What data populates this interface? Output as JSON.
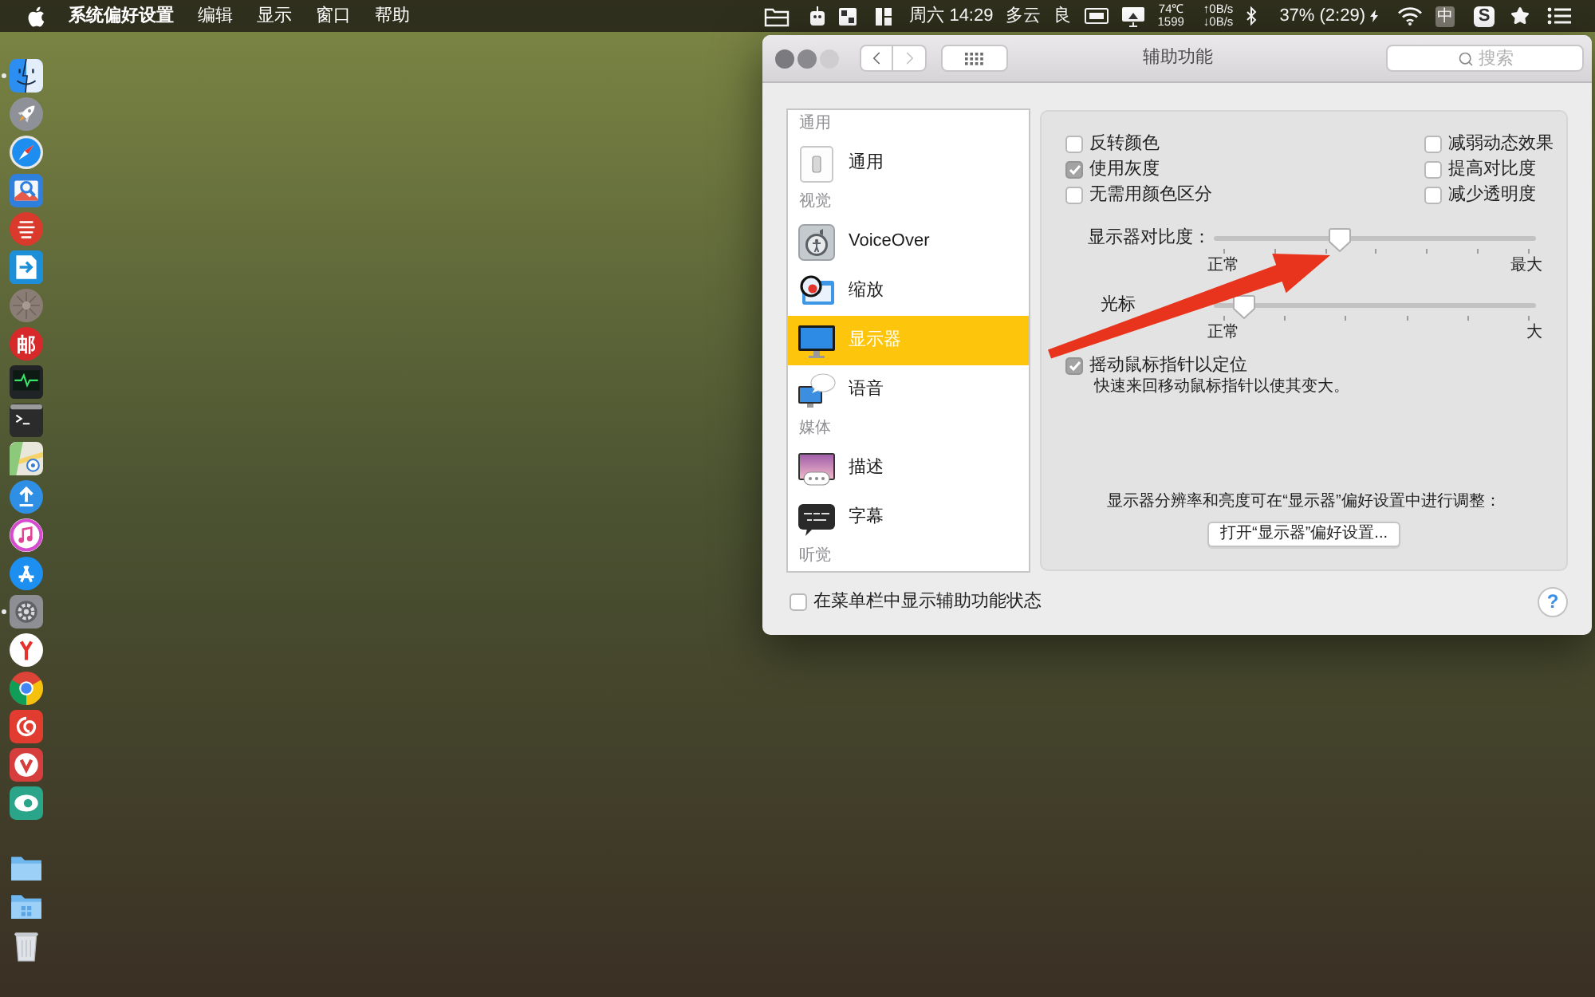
{
  "menu_bar": {
    "menus": [
      {
        "label": "系统偏好设置",
        "kind": "app"
      },
      {
        "label": "编辑",
        "kind": "menu"
      },
      {
        "label": "显示",
        "kind": "menu"
      },
      {
        "label": "窗口",
        "kind": "menu"
      },
      {
        "label": "帮助",
        "kind": "menu"
      }
    ],
    "status": {
      "clock": "周六 14:29",
      "weather": "多云",
      "air_quality": "良",
      "temperature": "74℃",
      "fan_speed": "1599",
      "upload_rate": "↑0B/s",
      "download_rate": "↓0B/s",
      "battery": "37% (2:29)",
      "input_method": "中",
      "input_app": "S"
    }
  },
  "dock": {
    "items": [
      {
        "running": true
      },
      {
        "running": false
      },
      {
        "running": false
      },
      {
        "running": false
      },
      {
        "running": false
      },
      {
        "running": false
      },
      {
        "running": false
      },
      {
        "running": false,
        "glyph": "邮"
      },
      {
        "running": false
      },
      {
        "running": false
      },
      {
        "running": false
      },
      {
        "running": false
      },
      {
        "running": false
      },
      {
        "running": false
      },
      {
        "running": true
      },
      {
        "running": false
      },
      {
        "running": false
      },
      {
        "running": false
      },
      {
        "running": false
      },
      {
        "running": false
      },
      {
        "running": false
      },
      {
        "running": false
      },
      {
        "running": false
      }
    ]
  },
  "window": {
    "title": "辅助功能",
    "back": {
      "disabled": false
    },
    "forward": {
      "disabled": true
    },
    "search": {
      "placeholder": "搜索"
    },
    "sidebar": [
      {
        "header": "通用",
        "items": [
          {
            "label": "通用",
            "selected": false
          }
        ]
      },
      {
        "header": "视觉",
        "items": [
          {
            "label": "VoiceOver",
            "selected": false
          },
          {
            "label": "缩放",
            "selected": false
          },
          {
            "label": "显示器",
            "selected": true
          },
          {
            "label": "语音",
            "selected": false
          }
        ]
      },
      {
        "header": "媒体",
        "items": [
          {
            "label": "描述",
            "selected": false
          },
          {
            "label": "字幕",
            "selected": false
          }
        ]
      },
      {
        "header": "听觉"
      }
    ],
    "options_left": [
      {
        "label": "反转颜色",
        "checked": false
      },
      {
        "label": "使用灰度",
        "checked": true
      },
      {
        "label": "无需用颜色区分",
        "checked": false
      }
    ],
    "options_right": [
      {
        "label": "减弱动态效果",
        "checked": false
      },
      {
        "label": "提高对比度",
        "checked": false
      },
      {
        "label": "减少透明度",
        "checked": false
      }
    ],
    "sliders": [
      {
        "label": "显示器对比度：",
        "level": 0.38,
        "min_label": "正常",
        "max_label": "最大"
      },
      {
        "label": "光标",
        "level": 0.07,
        "min_label": "正常",
        "max_label": "大"
      }
    ],
    "shake_pointer": {
      "label": "摇动鼠标指针以定位",
      "checked": true,
      "description": "快速来回移动鼠标指针以使其变大。"
    },
    "display_note": "显示器分辨率和亮度可在“显示器”偏好设置中进行调整：",
    "open_button": "打开“显示器”偏好设置...",
    "menu_bar_status": {
      "label": "在菜单栏中显示辅助功能状态",
      "checked": false
    },
    "help_button": "?"
  }
}
